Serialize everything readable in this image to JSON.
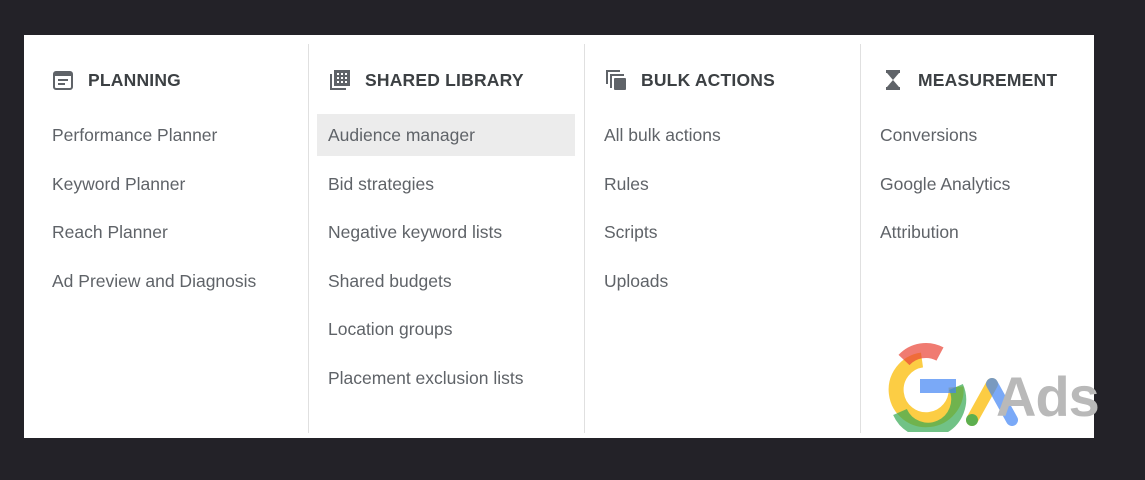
{
  "columns": [
    {
      "title": "PLANNING",
      "icon": "calendar-icon",
      "items": [
        "Performance Planner",
        "Keyword Planner",
        "Reach Planner",
        "Ad Preview and Diagnosis"
      ]
    },
    {
      "title": "SHARED LIBRARY",
      "icon": "library-icon",
      "items": [
        "Audience manager",
        "Bid strategies",
        "Negative keyword lists",
        "Shared budgets",
        "Location groups",
        "Placement exclusion lists"
      ]
    },
    {
      "title": "BULK ACTIONS",
      "icon": "copy-stack-icon",
      "items": [
        "All bulk actions",
        "Rules",
        "Scripts",
        "Uploads"
      ]
    },
    {
      "title": "MEASUREMENT",
      "icon": "hourglass-icon",
      "items": [
        "Conversions",
        "Google Analytics",
        "Attribution"
      ]
    }
  ],
  "highlighted_item": "Audience manager",
  "logo": {
    "text": "Ads",
    "icon": "google-ads-logo"
  },
  "colors": {
    "background": "#232228",
    "panel": "#ffffff",
    "highlight": "#ececec",
    "text": "#5f6368",
    "heading": "#3c4043"
  }
}
